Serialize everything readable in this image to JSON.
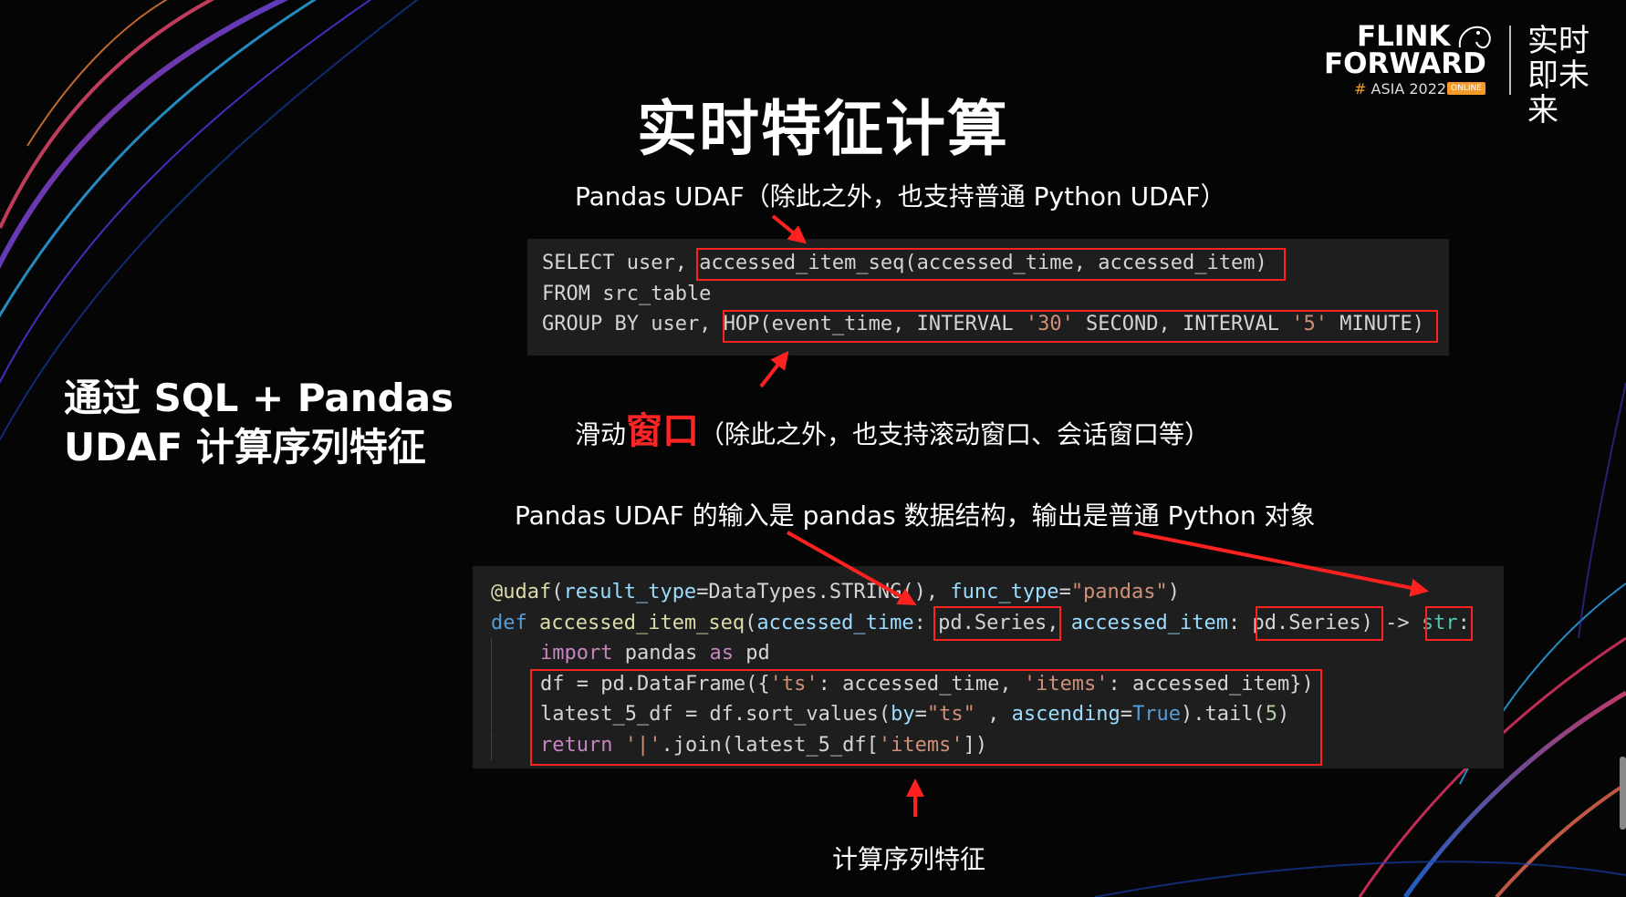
{
  "logo": {
    "line1": "FLINK",
    "line2": "FORWARD",
    "hash": "#",
    "asia": "ASIA 2022",
    "badge": "ONLINE",
    "slogan": "实时即未来"
  },
  "slide": {
    "title": "实时特征计算",
    "side_title": "通过 SQL + Pandas UDAF 计算序列特征",
    "annotation_udaf": "Pandas UDAF（除此之外，也支持普通 Python UDAF）",
    "annotation_window_prefix": "滑动",
    "annotation_window_word": "窗口",
    "annotation_window_suffix": "（除此之外，也支持滚动窗口、会话窗口等）",
    "annotation_io": "Pandas UDAF 的输入是 pandas 数据结构，输出是普通 Python 对象",
    "annotation_compute": "计算序列特征"
  },
  "sql_code": {
    "l1a": "SELECT user, ",
    "l1b": "accessed_item_seq(accessed_time, accessed_item)",
    "l2": "FROM src_table",
    "l3a": "GROUP BY user, ",
    "l3b": "HOP(event_time, INTERVAL ",
    "l3c": "'30'",
    "l3d": " SECOND, INTERVAL ",
    "l3e": "'5'",
    "l3f": " MINUTE)"
  },
  "py_code": {
    "d1": "@udaf",
    "d2": "(",
    "d3": "result_type",
    "d4": "=DataTypes.STRING(), ",
    "d5": "func_type",
    "d6": "=",
    "d7": "\"pandas\"",
    "d8": ")",
    "f1": "def",
    "f2": " accessed_item_seq",
    "f3": "(",
    "f4": "accessed_time",
    "f5": ": pd.Series, ",
    "f6": "accessed_item",
    "f7": ": pd.Series) -> ",
    "f8": "str",
    "f9": ":",
    "i1": "import",
    "i2": " pandas ",
    "i3": "as",
    "i4": " pd",
    "df1": "df = pd.DataFrame({",
    "df2": "'ts'",
    "df3": ": accessed_time, ",
    "df4": "'items'",
    "df5": ": accessed_item})",
    "l1": "latest_5_df = df.sort_values(",
    "l2": "by",
    "l3": "=",
    "l4": "\"ts\"",
    "l5": " , ",
    "l6": "ascending",
    "l7": "=",
    "l8": "True",
    "l9": ").tail(",
    "l10": "5",
    "l11": ")",
    "r1": "return",
    "r2": " ",
    "r3": "'|'",
    "r4": ".join(latest_5_df[",
    "r5": "'items'",
    "r6": "])"
  },
  "colors": {
    "background": "#050505",
    "code_bg": "#1e1e1e",
    "highlight_red": "#ff2020",
    "logo_orange": "#f39a2b"
  }
}
